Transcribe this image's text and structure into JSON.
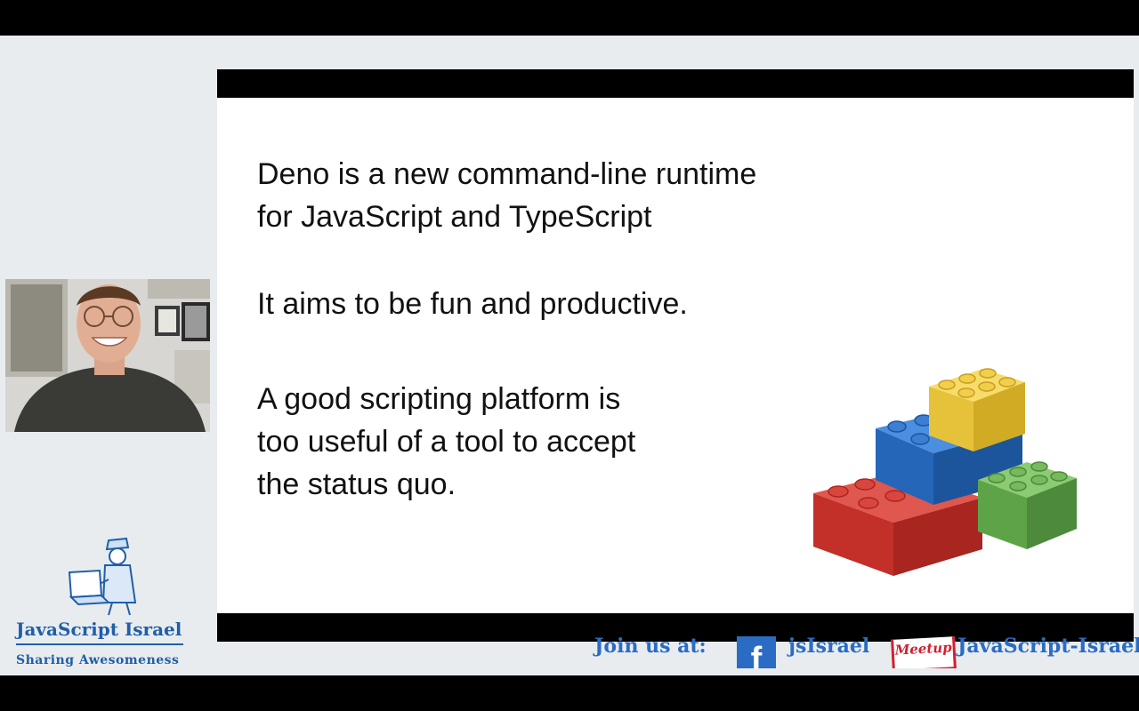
{
  "slide": {
    "paragraph_1": "Deno is a new command-line runtime\nfor JavaScript and TypeScript",
    "paragraph_2": "It aims to be fun and productive.",
    "paragraph_3": "A good scripting platform is\ntoo useful of a tool to accept\nthe status quo."
  },
  "branding": {
    "title": "JavaScript Israel",
    "subtitle": "Sharing Awesomeness"
  },
  "join_bar": {
    "label": "Join us at:",
    "facebook_icon": "facebook-icon",
    "facebook_glyph": "f",
    "facebook_handle": "jsIsrael",
    "meetup_icon": "meetup-icon",
    "meetup_text": "Meetup",
    "meetup_handle": "JavaScript-Israel"
  },
  "colors": {
    "brand_blue": "#2a6cc4",
    "meetup_red": "#d02030",
    "brick_red": "#d23a33",
    "brick_blue": "#2f7ad1",
    "brick_yellow": "#f2cf4a",
    "brick_green": "#6fb35a"
  }
}
